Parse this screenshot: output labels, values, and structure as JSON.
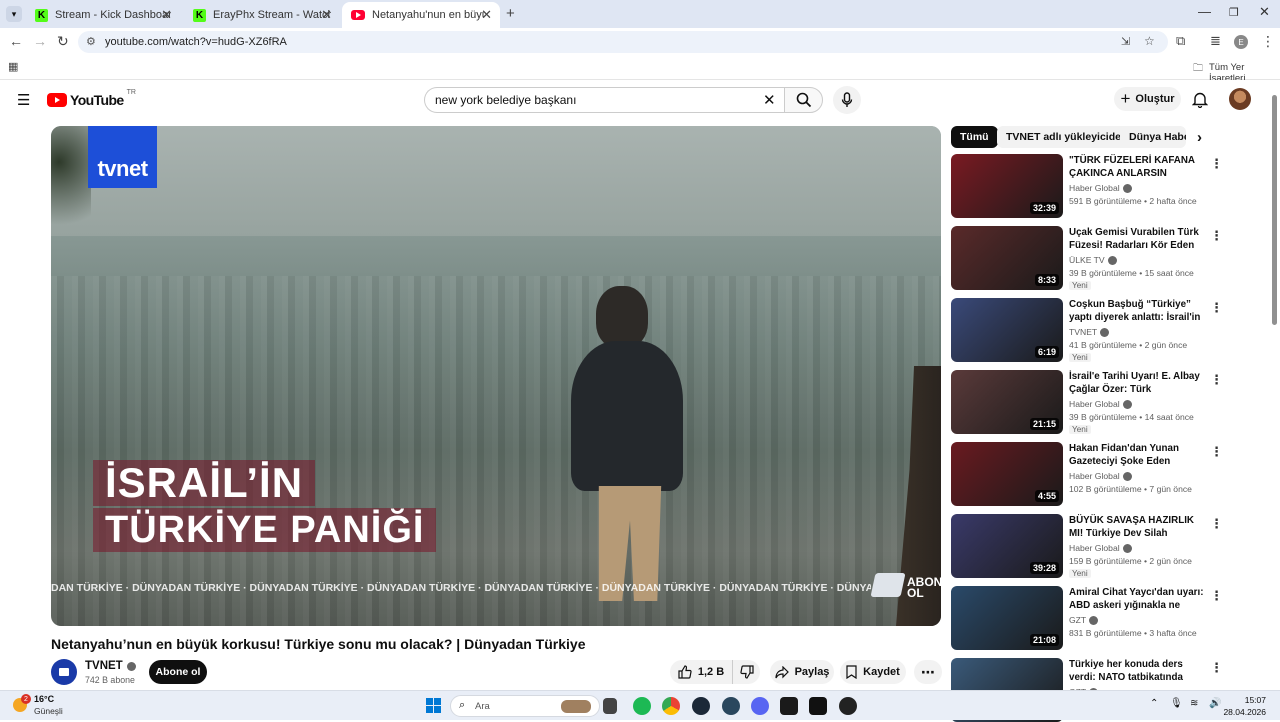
{
  "browser": {
    "tabs": [
      {
        "title": "Stream - Kick Dashboard",
        "icon": "kick-icon"
      },
      {
        "title": "ErayPhx Stream - Watch Live on",
        "icon": "kick-icon"
      },
      {
        "title": "Netanyahu'nun en büyük korkus",
        "icon": "youtube-icon",
        "active": true
      }
    ],
    "url": "youtube.com/watch?v=hudG-XZ6fRA",
    "bookmarks_label": "Tüm Yer İşaretleri"
  },
  "youtube": {
    "logo_text": "YouTube",
    "country_code": "TR",
    "search_value": "new york belediye başkanı",
    "create_label": "Oluştur"
  },
  "video": {
    "overlay_logo": "tvnet",
    "overlay_line1": "İSRAİL’İN",
    "overlay_line2": "TÜRKİYE PANİĞİ",
    "ticker": "DAN TÜRKİYE · DÜNYADAN TÜRKİYE · DÜNYADAN TÜRKİYE · DÜNYADAN TÜRKİYE · DÜNYADAN TÜRKİYE · DÜNYADAN TÜRKİYE · DÜNYADAN TÜRKİYE · DÜNYADAN TÜRKİYE · DÜNYA",
    "subscribe_badge": "ABONE OL",
    "title": "Netanyahu’nun en büyük korkusu! Türkiye sonu mu olacak? | Dünyadan Türkiye",
    "channel": "TVNET",
    "subscribers": "742 B abone",
    "subscribe_label": "Abone ol",
    "likes": "1,2 B",
    "share_label": "Paylaş",
    "save_label": "Kaydet"
  },
  "chips": [
    "Tümü",
    "TVNET adlı yükleyiciden",
    "Dünya Haberl"
  ],
  "recommendations": [
    {
      "title": "\"TÜRK FÜZELERİ KAFANA ÇAKINCA ANLARSIN GEÇMİŞ OLSUN\"",
      "channel": "Haber Global",
      "meta": "591 B görüntüleme • 2 hafta önce",
      "duration": "32:39",
      "badge": "",
      "color": "#7a1a22"
    },
    {
      "title": "Uçak Gemisi Vurabilen Türk Füzesi! Radarları Kör Eden Eşsiz Silah",
      "channel": "ÜLKE TV",
      "meta": "39 B görüntüleme • 15 saat önce",
      "duration": "8:33",
      "badge": "Yeni",
      "color": "#5a2a2a"
    },
    {
      "title": "Coşkun Başbuğ “Türkiye” yaptı diyerek anlattı: İsrail'in en büyük korkusu",
      "channel": "TVNET",
      "meta": "41 B görüntüleme • 2 gün önce",
      "duration": "6:19",
      "badge": "Yeni",
      "color": "#3a4a7a"
    },
    {
      "title": "İsrail'e Tarihi Uyarı! E. Albay Çağlar Özer: Türk Ordusundan Kaçamazsın",
      "channel": "Haber Global",
      "meta": "39 B görüntüleme • 14 saat önce",
      "duration": "21:15",
      "badge": "Yeni",
      "color": "#5a3a3a"
    },
    {
      "title": "Hakan Fidan'dan Yunan Gazeteciyi Şoke Eden Cevap!",
      "channel": "Haber Global",
      "meta": "102 B görüntüleme • 7 gün önce",
      "duration": "4:55",
      "badge": "",
      "color": "#6a1a20"
    },
    {
      "title": "BÜYÜK SAVAŞA HAZIRLIK MI! Türkiye Dev Silah Sistemlerini Üretiyor",
      "channel": "Haber Global",
      "meta": "159 B görüntüleme • 2 gün önce",
      "duration": "39:28",
      "badge": "Yeni",
      "color": "#3a3a6a"
    },
    {
      "title": "Amiral Cihat Yaycı'dan uyarı: ABD askeri yığınakla ne amaçlıyor?",
      "channel": "GZT",
      "meta": "831 B görüntüleme • 3 hafta önce",
      "duration": "21:08",
      "badge": "",
      "color": "#2a4a6a"
    },
    {
      "title": "Türkiye her konuda ders verdi: NATO tatbikatında neler oldu?",
      "channel": "GZT",
      "meta": "",
      "duration": "",
      "badge": "",
      "color": "#3a5a7a"
    }
  ],
  "taskbar": {
    "weather_temp": "16°C",
    "weather_desc": "Güneşli",
    "notif_count": "2",
    "search_placeholder": "Ara",
    "time": "15:07",
    "date": "28.04.2026"
  }
}
